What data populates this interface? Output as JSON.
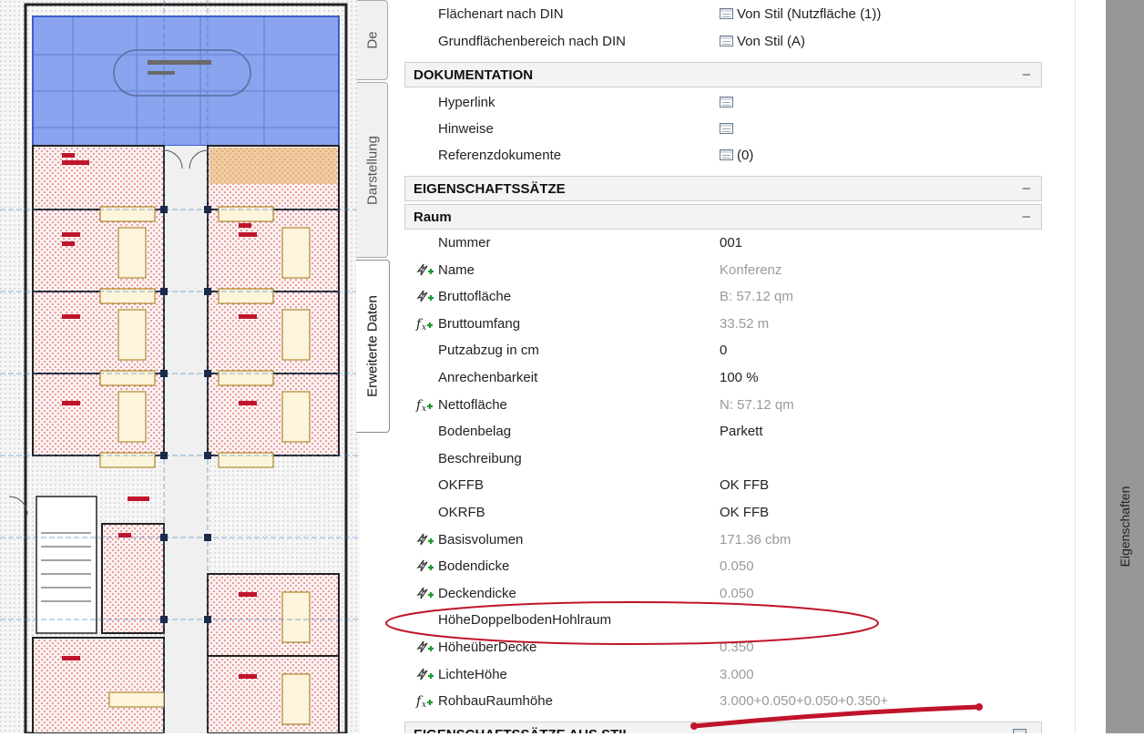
{
  "side_tabs": {
    "top": "De",
    "darstellung": "Darstellung",
    "erweiterte": "Erweiterte Daten"
  },
  "right_tab": "Eigenschaften",
  "colors": {
    "room_highlight": "#5a7fe0",
    "wall": "#222222",
    "hatch_red": "#d23b3b",
    "furniture": "#c89a3a",
    "annotation_red": "#c0142a"
  },
  "properties": {
    "din_rows": [
      {
        "label": "Flächenart nach DIN",
        "value": "Von Stil (Nutzfläche (1))",
        "icon": "table-icon"
      },
      {
        "label": "Grundflächenbereich nach DIN",
        "value": "Von Stil (A)",
        "icon": "table-icon"
      }
    ],
    "sections": {
      "dokumentation": "DOKUMENTATION",
      "eigenschaftssaetze": "EIGENSCHAFTSSÄTZE",
      "raum": "Raum",
      "stil": "EIGENSCHAFTSSÄTZE AUS STIL"
    },
    "collapse_symbol": "–",
    "doc_rows": [
      {
        "label": "Hyperlink",
        "value": ""
      },
      {
        "label": "Hinweise",
        "value": ""
      },
      {
        "label": "Referenzdokumente",
        "value": "(0)"
      }
    ],
    "raum_rows": [
      {
        "icon": "",
        "label": "Nummer",
        "value": "001",
        "grey": false
      },
      {
        "icon": "lightning-plus-icon",
        "label": "Name",
        "value": "Konferenz",
        "grey": true
      },
      {
        "icon": "lightning-plus-icon",
        "label": "Bruttofläche",
        "value": "B: 57.12 qm",
        "grey": true
      },
      {
        "icon": "formula-icon",
        "label": "Bruttoumfang",
        "value": "33.52 m",
        "grey": true
      },
      {
        "icon": "",
        "label": "Putzabzug in cm",
        "value": "0",
        "grey": false
      },
      {
        "icon": "",
        "label": "Anrechenbarkeit",
        "value": "100 %",
        "grey": false
      },
      {
        "icon": "formula-icon",
        "label": "Nettofläche",
        "value": "N: 57.12 qm",
        "grey": true
      },
      {
        "icon": "",
        "label": "Bodenbelag",
        "value": "Parkett",
        "grey": false
      },
      {
        "icon": "",
        "label": "Beschreibung",
        "value": "",
        "grey": false
      },
      {
        "icon": "",
        "label": "OKFFB",
        "value": "OK FFB",
        "grey": false
      },
      {
        "icon": "",
        "label": "OKRFB",
        "value": "OK FFB",
        "grey": false
      },
      {
        "icon": "lightning-plus-icon",
        "label": "Basisvolumen",
        "value": "171.36 cbm",
        "grey": true
      },
      {
        "icon": "lightning-plus-icon",
        "label": "Bodendicke",
        "value": "0.050",
        "grey": true
      },
      {
        "icon": "lightning-plus-icon",
        "label": "Deckendicke",
        "value": "0.050",
        "grey": true
      },
      {
        "icon": "",
        "label": "HöheDoppelbodenHohlraum",
        "value": "",
        "grey": false
      },
      {
        "icon": "lightning-plus-icon",
        "label": "HöheüberDecke",
        "value": "0.350",
        "grey": true
      },
      {
        "icon": "lightning-plus-icon",
        "label": "LichteHöhe",
        "value": "3.000",
        "grey": true
      },
      {
        "icon": "formula-icon",
        "label": "RohbauRaumhöhe",
        "value": "3.000+0.050+0.050+0.350+",
        "grey": true
      }
    ]
  }
}
